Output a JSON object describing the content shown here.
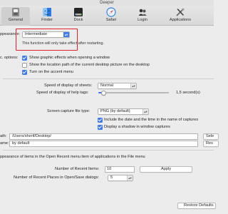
{
  "window": {
    "title": "Deeper"
  },
  "toolbar": {
    "items": [
      {
        "label": "General",
        "icon": "switch-icon",
        "active": true
      },
      {
        "label": "Finder",
        "icon": "finder-icon",
        "active": false
      },
      {
        "label": "Dock",
        "icon": "dock-icon",
        "active": false
      },
      {
        "label": "Safari",
        "icon": "safari-icon",
        "active": false
      },
      {
        "label": "Login",
        "icon": "login-icon",
        "active": false
      },
      {
        "label": "Applications",
        "icon": "applications-icon",
        "active": false
      }
    ]
  },
  "appearance": {
    "label": "ppearance:",
    "value": "Intermediate",
    "note": "This function will only take effect after restarting."
  },
  "options": {
    "label": "c. options:",
    "items": [
      {
        "label": "Show graphic effects when opening a window",
        "checked": true
      },
      {
        "label": "Show the location path of the current desktop picture on the desktop",
        "checked": false
      },
      {
        "label": "Turn on the accent menu",
        "checked": true
      }
    ]
  },
  "sheets": {
    "label": "Speed of display of sheets:",
    "value": "Normal"
  },
  "help_tags": {
    "label": "Speed of display of help tags:",
    "value": "1,5 second(s)",
    "level": 0.08
  },
  "capture": {
    "label": "Screen capture file type:",
    "value": "PNG (by default)",
    "include_date": {
      "label": "Include the date and the time in the name of captures",
      "checked": true
    },
    "shadow": {
      "label": "Display a shadow in window captures",
      "checked": true
    }
  },
  "path": {
    "label": "ath:",
    "value": "/Users/sherif/Desktop/",
    "button": "Sele"
  },
  "name": {
    "label": "ame:",
    "value": "by default",
    "button": "Res"
  },
  "recent": {
    "heading": "ppearance of items in the Open Recent menu item of applications in the File menu",
    "items_label": "Number of Recent Items:",
    "items_value": "10",
    "apply_label": "Apply",
    "places_label": "Number of Recent Places in Open/Save dialogs:",
    "places_value": "5"
  },
  "restore_button": "Restore Defaults",
  "colors": {
    "accent": "#3b79f1",
    "highlight": "#e3212a"
  }
}
